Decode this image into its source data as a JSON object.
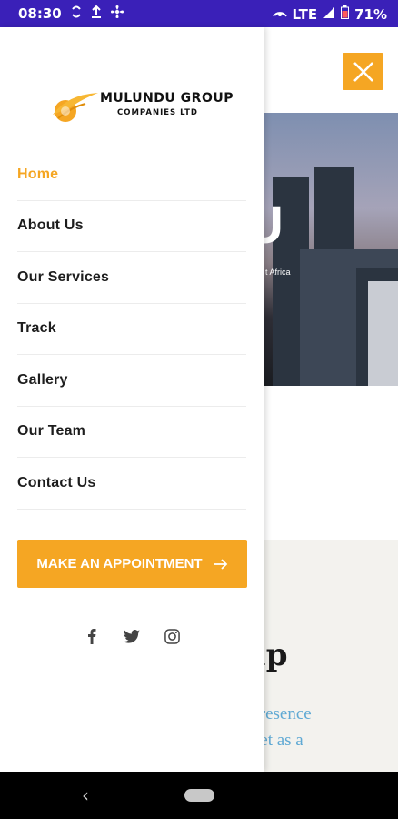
{
  "status_bar": {
    "time": "08:30",
    "network": "LTE",
    "battery": "71%"
  },
  "brand": {
    "name": "MULUNDU GROUP",
    "subtitle": "COMPANIES LTD",
    "accent": "#f5a623"
  },
  "menu": {
    "items": [
      {
        "label": "Home",
        "active": true
      },
      {
        "label": "About Us",
        "active": false
      },
      {
        "label": "Our Services",
        "active": false
      },
      {
        "label": "Track",
        "active": false
      },
      {
        "label": "Gallery",
        "active": false
      },
      {
        "label": "Our Team",
        "active": false
      },
      {
        "label": "Contact Us",
        "active": false
      }
    ]
  },
  "appointment_button": {
    "label": "MAKE AN APPOINTMENT",
    "icon": "arrow-right-icon"
  },
  "social": {
    "icons": [
      "facebook-icon",
      "twitter-icon",
      "instagram-icon"
    ]
  },
  "background": {
    "hero_big_text": "U",
    "hero_small_text": "t Africa",
    "about_title": "up",
    "about_text_line1": "g presence",
    "about_text_line2": "arket as a"
  }
}
